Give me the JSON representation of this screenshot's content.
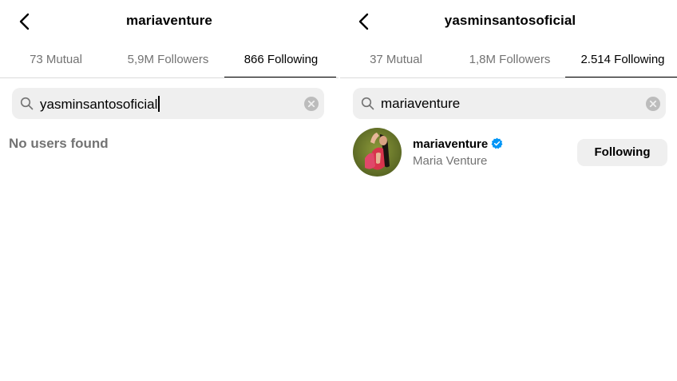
{
  "left": {
    "title": "mariaventure",
    "tabs": [
      {
        "label": "73 Mutual"
      },
      {
        "label": "5,9M Followers"
      },
      {
        "label": "866 Following"
      }
    ],
    "active_tab": 2,
    "search": {
      "value": "yasminsantosoficial",
      "search_icon": "search-icon",
      "clear_icon": "clear-icon"
    },
    "empty_message": "No users found"
  },
  "right": {
    "title": "yasminsantosoficial",
    "tabs": [
      {
        "label": "37 Mutual"
      },
      {
        "label": "1,8M Followers"
      },
      {
        "label": "2.514 Following"
      }
    ],
    "active_tab": 2,
    "search": {
      "value": "mariaventure",
      "search_icon": "search-icon",
      "clear_icon": "clear-icon"
    },
    "results": [
      {
        "username": "mariaventure",
        "full_name": "Maria Venture",
        "verified": true,
        "button_label": "Following"
      }
    ]
  },
  "colors": {
    "verified": "#0095f6",
    "secondary_text": "#737373",
    "input_bg": "#efefef",
    "divider": "#dbdbdb"
  }
}
